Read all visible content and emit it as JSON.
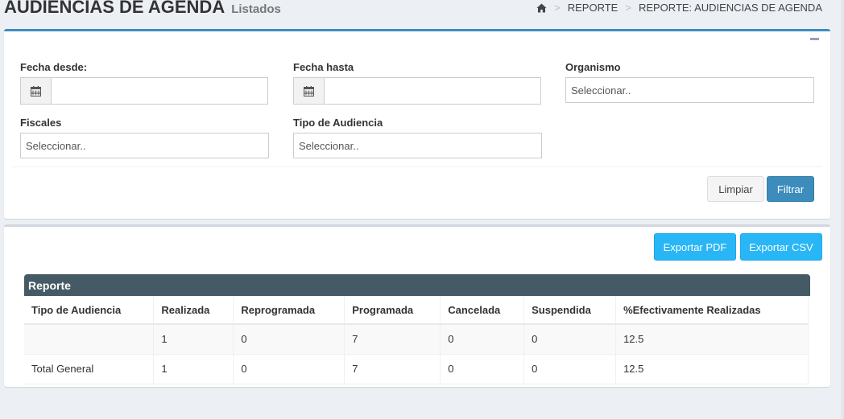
{
  "page": {
    "title": "AUDIENCIAS DE AGENDA",
    "subtitle": "Listados"
  },
  "breadcrumb": {
    "icon": "home-icon",
    "items": [
      "REPORTE",
      "REPORTE: AUDIENCIAS DE AGENDA"
    ]
  },
  "filters": {
    "fecha_desde": {
      "label": "Fecha desde:",
      "value": "",
      "icon": "calendar-icon"
    },
    "fecha_hasta": {
      "label": "Fecha hasta",
      "value": "",
      "icon": "calendar-icon"
    },
    "organismo": {
      "label": "Organismo",
      "placeholder": "Seleccionar.."
    },
    "fiscales": {
      "label": "Fiscales",
      "placeholder": "Seleccionar.."
    },
    "tipo_audiencia": {
      "label": "Tipo de Audiencia",
      "placeholder": "Seleccionar.."
    },
    "clear_label": "Limpiar",
    "filter_label": "Filtrar"
  },
  "export": {
    "pdf_label": "Exportar PDF",
    "csv_label": "Exportar CSV"
  },
  "report": {
    "title": "Reporte",
    "columns": [
      "Tipo de Audiencia",
      "Realizada",
      "Reprogramada",
      "Programada",
      "Cancelada",
      "Suspendida",
      "%Efectivamente Realizadas"
    ],
    "rows": [
      [
        "",
        "1",
        "0",
        "7",
        "0",
        "0",
        "12.5"
      ],
      [
        "Total General",
        "1",
        "0",
        "7",
        "0",
        "0",
        "12.5"
      ]
    ]
  },
  "colors": {
    "primary": "#3c8dbc",
    "info": "#29b6f6",
    "report_header": "#455a64",
    "background": "#ecf0f5"
  }
}
